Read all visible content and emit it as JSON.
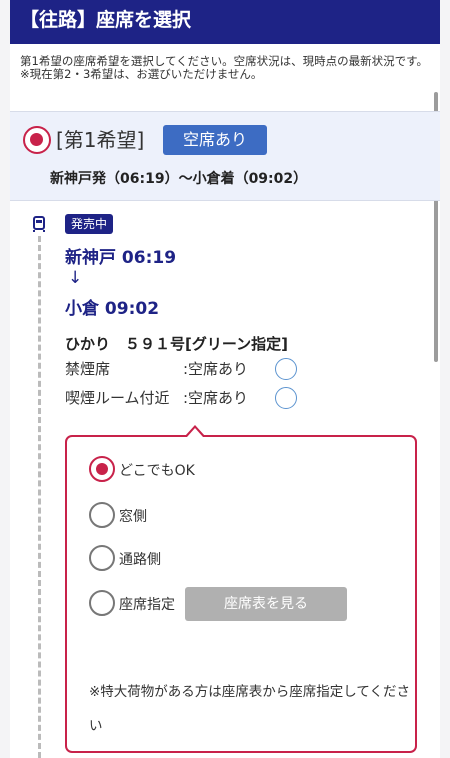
{
  "header": {
    "title": "【往路】座席を選択"
  },
  "notes": {
    "line1": "第1希望の座席希望を選択してください。空席状況は、現時点の最新状況です。",
    "line2": "※現在第2・3希望は、お選びいただけません。"
  },
  "choice": {
    "label": "[第1希望]",
    "vacancy": "空席あり",
    "route": "新神戸発（06:19）〜小倉着（09:02）"
  },
  "train": {
    "sale_status": "発売中",
    "departure": "新神戸 06:19",
    "arrow": "↓",
    "arrival": "小倉 09:02",
    "name": "ひかり　５９１号[グリーン指定]",
    "seat_types": [
      {
        "label": "禁煙席",
        "status": ":空席あり"
      },
      {
        "label": "喫煙ルーム付近",
        "status": ":空席あり"
      }
    ]
  },
  "preferences": {
    "options": [
      {
        "label": "どこでもOK",
        "selected": true
      },
      {
        "label": "窓側",
        "selected": false
      },
      {
        "label": "通路側",
        "selected": false
      },
      {
        "label": "座席指定",
        "selected": false
      }
    ],
    "seat_map_button": "座席表を見る",
    "note": "※特大荷物がある方は座席表から座席指定してください"
  },
  "colors": {
    "header_bg": "#1e2386",
    "accent_red": "#c8224a",
    "vacancy_blue": "#3d6cc3"
  }
}
